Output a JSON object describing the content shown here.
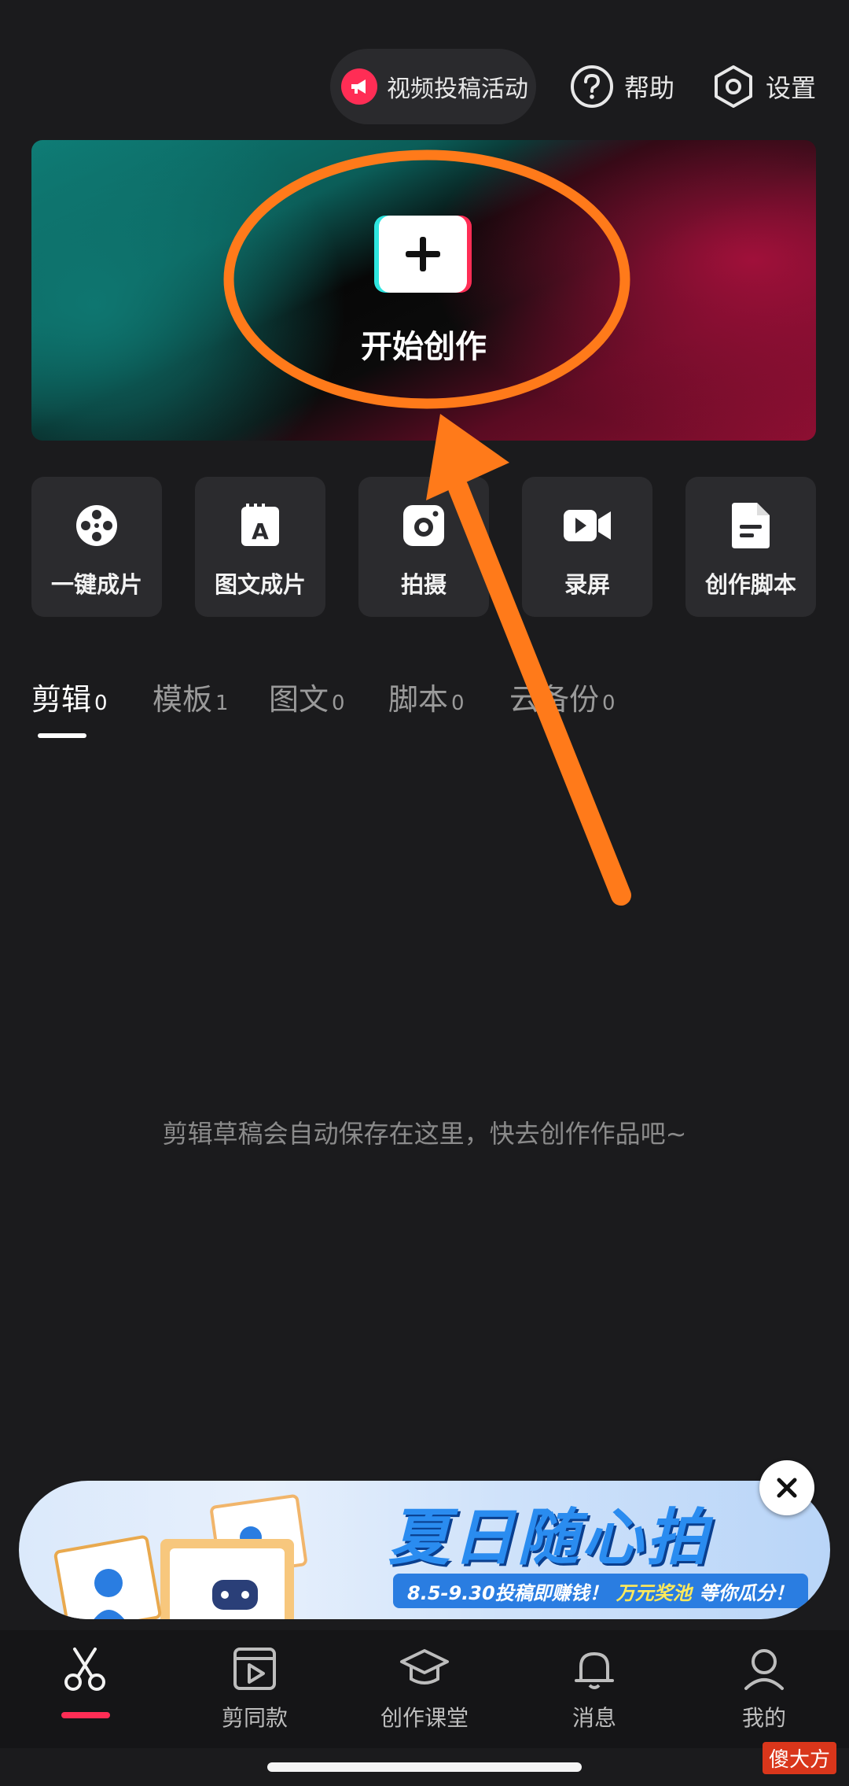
{
  "header": {
    "activity_label": "视频投稿活动",
    "help_label": "帮助",
    "settings_label": "设置"
  },
  "banner": {
    "cta_label": "开始创作"
  },
  "tools": [
    {
      "label": "一键成片",
      "icon": "film-reel-icon"
    },
    {
      "label": "图文成片",
      "icon": "text-image-icon"
    },
    {
      "label": "拍摄",
      "icon": "camera-icon"
    },
    {
      "label": "录屏",
      "icon": "screen-record-icon"
    },
    {
      "label": "创作脚本",
      "icon": "script-document-icon"
    }
  ],
  "tabs": [
    {
      "label": "剪辑",
      "count": "0",
      "active": true
    },
    {
      "label": "模板",
      "count": "1"
    },
    {
      "label": "图文",
      "count": "0"
    },
    {
      "label": "脚本",
      "count": "0"
    },
    {
      "label": "云备份",
      "count": "0"
    }
  ],
  "empty_message": "剪辑草稿会自动保存在这里，快去创作作品吧~",
  "promo": {
    "title": "夏日随心拍",
    "subtitle_pre": "8.5-9.30投稿即赚钱！",
    "subtitle_highlight": "万元奖池",
    "subtitle_post": "等你瓜分！"
  },
  "bottom_nav": [
    {
      "label": "",
      "icon": "scissors-icon",
      "active": true
    },
    {
      "label": "剪同款",
      "icon": "template-clip-icon"
    },
    {
      "label": "创作课堂",
      "icon": "graduation-cap-icon"
    },
    {
      "label": "消息",
      "icon": "bell-icon"
    },
    {
      "label": "我的",
      "icon": "profile-icon"
    }
  ],
  "watermark": "傻大方",
  "colors": {
    "accent": "#ff2d55",
    "annotation": "#ff7a1a",
    "background": "#1b1b1d"
  }
}
